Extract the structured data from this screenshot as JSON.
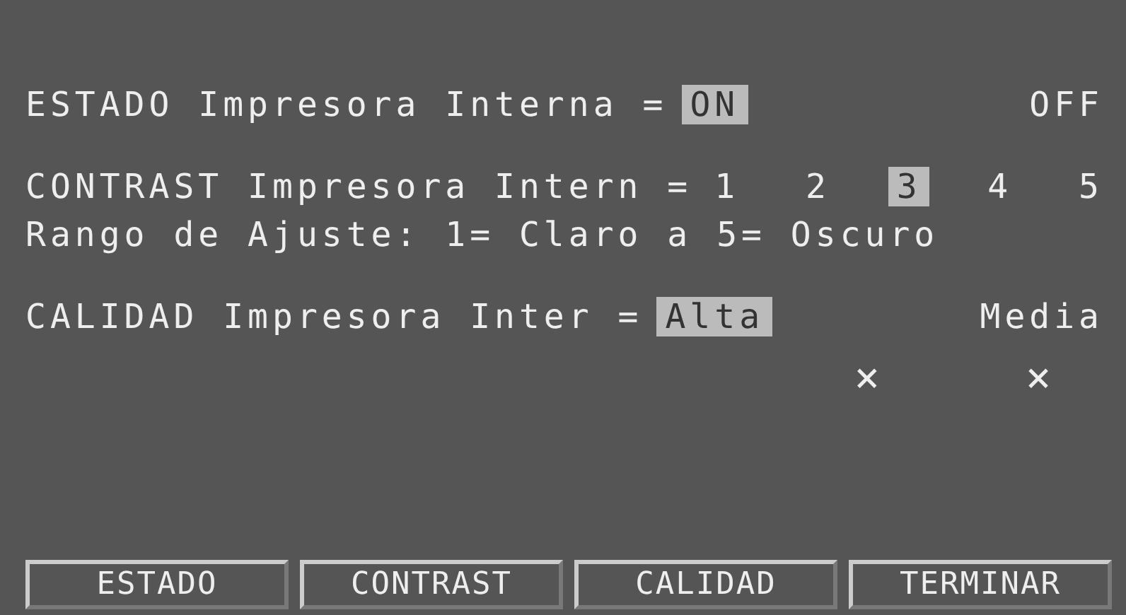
{
  "settings": [
    {
      "label": "ESTADO Impresora Interna =",
      "options": [
        {
          "label": "ON",
          "selected": true
        },
        {
          "label": "OFF",
          "selected": false
        }
      ]
    },
    {
      "label": "CONTRAST Impresora Intern =",
      "options": [
        {
          "label": "1",
          "selected": false
        },
        {
          "label": "2",
          "selected": false
        },
        {
          "label": "3",
          "selected": true
        },
        {
          "label": "4",
          "selected": false
        },
        {
          "label": "5",
          "selected": false
        }
      ],
      "note": "Rango de Ajuste: 1= Claro a 5= Oscuro"
    },
    {
      "label": "CALIDAD Impresora Inter =",
      "options": [
        {
          "label": "Alta",
          "selected": true
        },
        {
          "label": "Media",
          "selected": false
        }
      ],
      "marks": [
        "×",
        "×"
      ]
    }
  ],
  "softkeys": [
    "ESTADO",
    "CONTRAST",
    "CALIDAD",
    "TERMINAR"
  ]
}
